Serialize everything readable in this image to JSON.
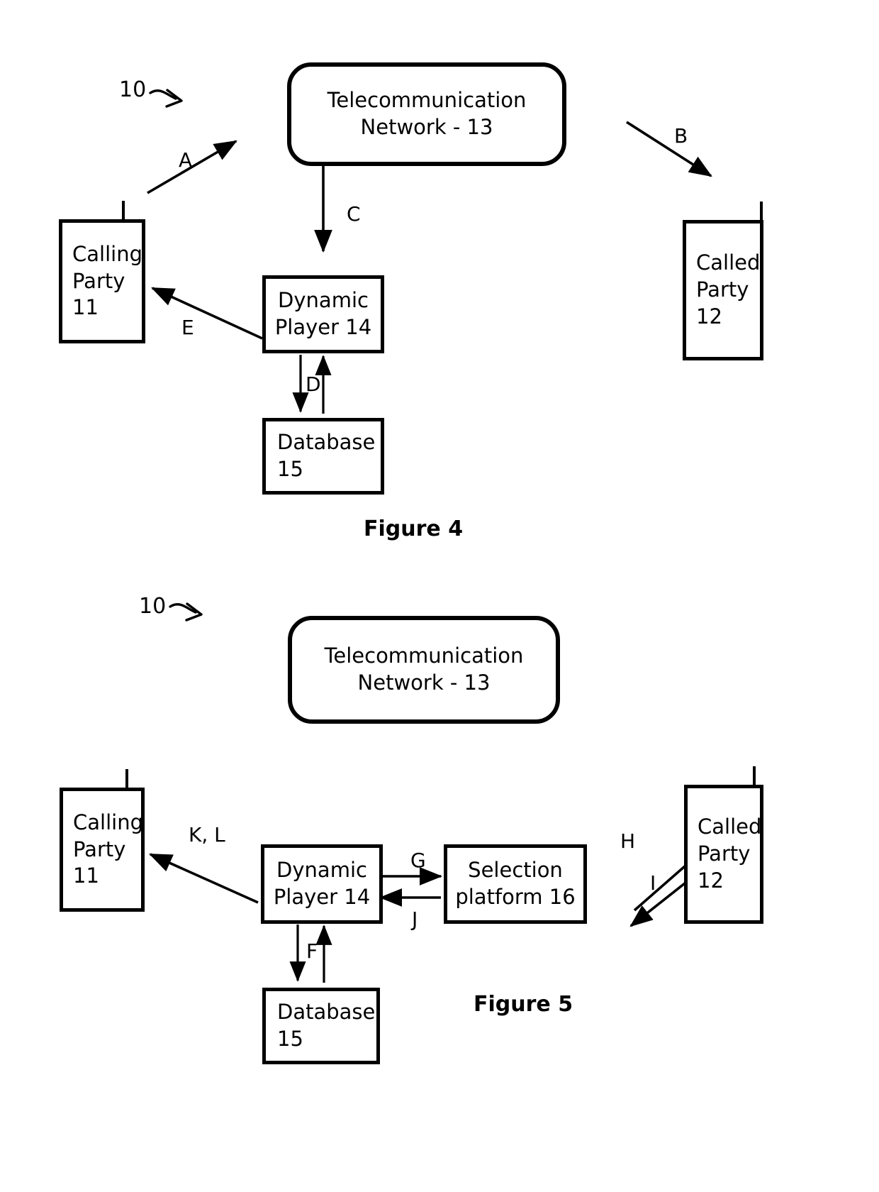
{
  "document": {
    "kind": "patent-figure-sheet",
    "figures": [
      "Figure 4",
      "Figure 5"
    ]
  },
  "figure4": {
    "caption": "Figure 4",
    "system_ref": "10",
    "nodes": {
      "network": {
        "line1": "Telecommunication",
        "line2": "Network - 13"
      },
      "calling_party": {
        "line1": "Calling",
        "line2": "Party",
        "line3": "11"
      },
      "called_party": {
        "line1": "Called",
        "line2": "Party",
        "line3": "12"
      },
      "dynamic_player": {
        "line1": "Dynamic",
        "line2": "Player 14"
      },
      "database": {
        "line1": "Database",
        "line2": "15"
      }
    },
    "arrows": {
      "a": "A",
      "b": "B",
      "c": "C",
      "d": "D",
      "e": "E"
    }
  },
  "figure5": {
    "caption": "Figure 5",
    "system_ref": "10",
    "nodes": {
      "network": {
        "line1": "Telecommunication",
        "line2": "Network - 13"
      },
      "calling_party": {
        "line1": "Calling",
        "line2": "Party",
        "line3": "11"
      },
      "called_party": {
        "line1": "Called",
        "line2": "Party",
        "line3": "12"
      },
      "dynamic_player": {
        "line1": "Dynamic",
        "line2": "Player 14"
      },
      "selection_platform": {
        "line1": "Selection",
        "line2": "platform 16"
      },
      "database": {
        "line1": "Database",
        "line2": "15"
      }
    },
    "arrows": {
      "kl": "K, L",
      "f": "F",
      "g": "G",
      "j": "J",
      "h": "H",
      "i": "I"
    }
  },
  "style": {
    "ink": "#000000",
    "paper": "#ffffff"
  }
}
